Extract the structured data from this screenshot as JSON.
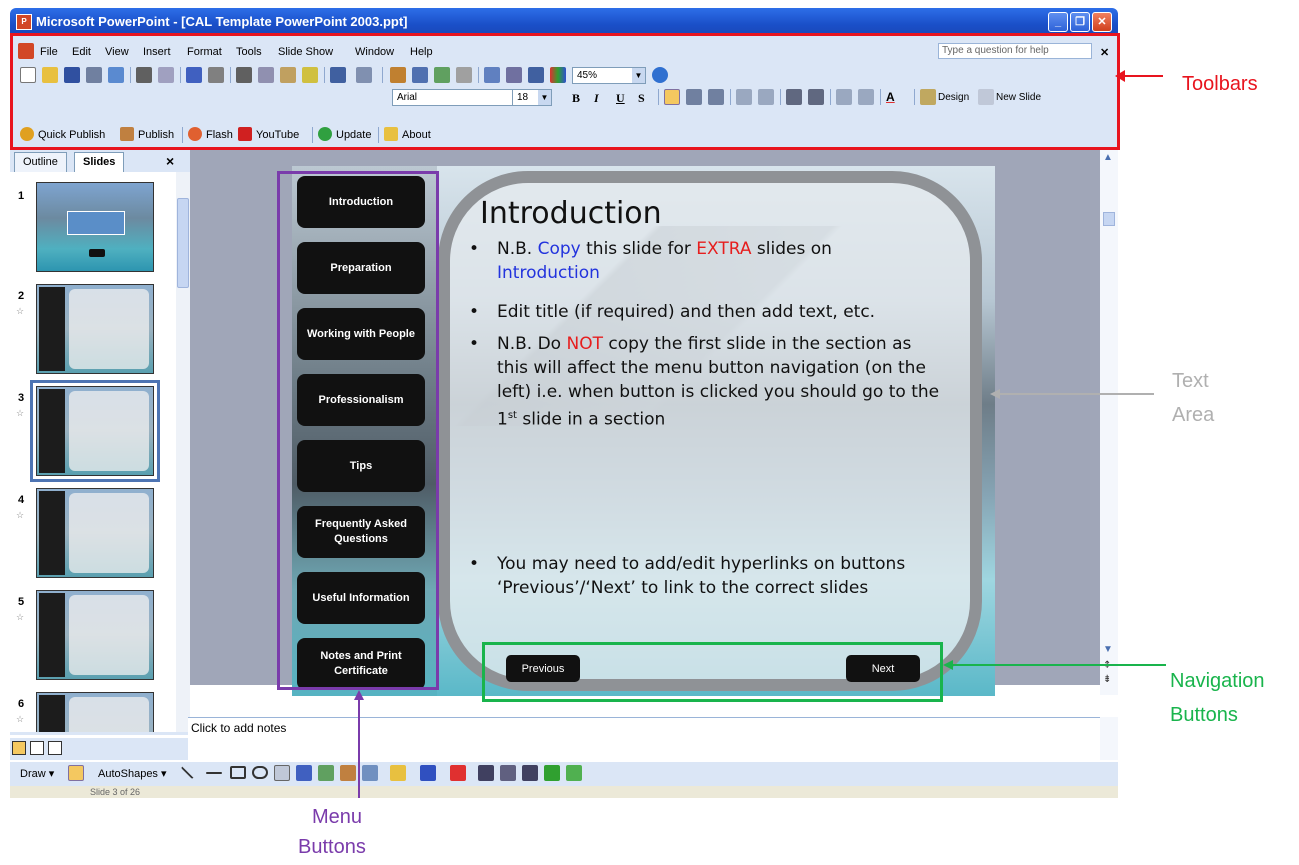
{
  "window": {
    "title": "Microsoft PowerPoint - [CAL Template PowerPoint 2003.ppt]",
    "app_icon": "P",
    "buttons": [
      "_",
      "❐",
      "✕"
    ]
  },
  "menu": {
    "items": [
      "File",
      "Edit",
      "View",
      "Insert",
      "Format",
      "Tools",
      "Slide Show",
      "Window",
      "Help"
    ],
    "help_placeholder": "Type a question for help",
    "close": "✕"
  },
  "standard_toolbar": {
    "zoom": "45%"
  },
  "formatting_toolbar": {
    "font": "Arial",
    "size": "18",
    "bold": "B",
    "italic": "I",
    "underline": "U",
    "shadow": "S",
    "font_color": "A",
    "design_label": "Design",
    "new_slide_label": "New Slide"
  },
  "custom_toolbar": {
    "quick_publish": "Quick Publish",
    "publish": "Publish",
    "flash": "Flash",
    "youtube": "YouTube",
    "update": "Update",
    "about": "About"
  },
  "left_pane": {
    "tabs": [
      "Outline",
      "Slides"
    ],
    "close": "×",
    "thumbnails": [
      {
        "num": "1"
      },
      {
        "num": "2"
      },
      {
        "num": "3"
      },
      {
        "num": "4"
      },
      {
        "num": "5"
      },
      {
        "num": "6"
      }
    ]
  },
  "slide": {
    "menu_buttons": [
      "Introduction",
      "Preparation",
      "Working with People",
      "Professionalism",
      "Tips",
      "Frequently Asked Questions",
      "Useful Information",
      "Notes and Print Certificate"
    ],
    "title": "Introduction",
    "bullets": {
      "b1_pre": "N.B. ",
      "b1_copy": "Copy",
      "b1_mid": " this slide for ",
      "b1_extra": "EXTRA",
      "b1_post": " slides on ",
      "b1_intro": "Introduction",
      "b2": "Edit title (if required) and then add text, etc.",
      "b3_pre": "N.B. Do ",
      "b3_not": "NOT",
      "b3_post": " copy the first slide in the section as this will affect the menu button navigation (on the left) i.e. when button is clicked you should go to the 1",
      "b3_sup": "st",
      "b3_end": " slide in a section",
      "b4": "You may need to add/edit hyperlinks on buttons ‘Previous’/‘Next’ to link to the correct slides"
    },
    "previous": "Previous",
    "next": "Next"
  },
  "notes": {
    "placeholder": "Click to add notes"
  },
  "drawing_toolbar": {
    "draw": "Draw ▾",
    "autoshapes": "AutoShapes ▾"
  },
  "status": {
    "slide_count": "Slide 3 of 26"
  },
  "annotations": {
    "toolbars": "Toolbars",
    "text_area_1": "Text",
    "text_area_2": "Area",
    "navigation_1": "Navigation",
    "navigation_2": "Buttons",
    "menu_1": "Menu",
    "menu_2": "Buttons"
  },
  "colors": {
    "toolbar_box": "#e8141e",
    "menu_box": "#7a3bab",
    "nav_box": "#19b44c",
    "text_area_label": "#b0b0b0"
  }
}
